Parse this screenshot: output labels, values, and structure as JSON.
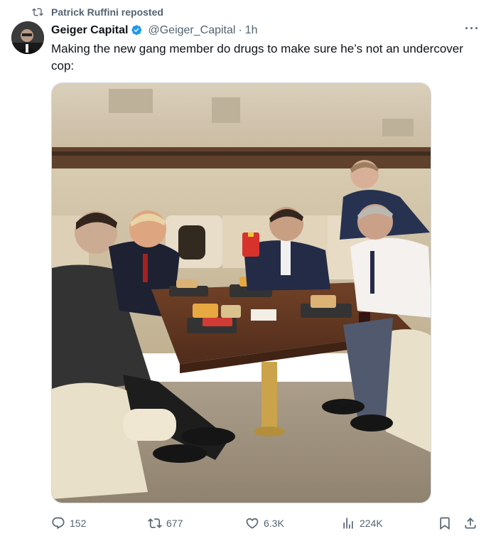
{
  "repost": {
    "label": "Patrick Ruffini reposted",
    "icon": "repost-icon"
  },
  "author": {
    "display_name": "Geiger Capital",
    "handle": "@Geiger_Capital",
    "time": "1h",
    "separator": "·",
    "verified": true,
    "verified_color": "#1d9bf0"
  },
  "more_label": "···",
  "tweet": {
    "text": "Making the new gang member do drugs to make sure he’s not an undercover cop:"
  },
  "media": {
    "type": "photo"
  },
  "actions": {
    "replies": {
      "icon": "reply-icon",
      "count": "152"
    },
    "reposts": {
      "icon": "repost-icon",
      "count": "677"
    },
    "likes": {
      "icon": "heart-icon",
      "count": "6.3K"
    },
    "views": {
      "icon": "analytics-icon",
      "count": "224K"
    },
    "bookmark": {
      "icon": "bookmark-icon"
    },
    "share": {
      "icon": "share-icon"
    }
  },
  "colors": {
    "text": "#0f1419",
    "secondary": "#536471",
    "accent": "#1d9bf0"
  }
}
